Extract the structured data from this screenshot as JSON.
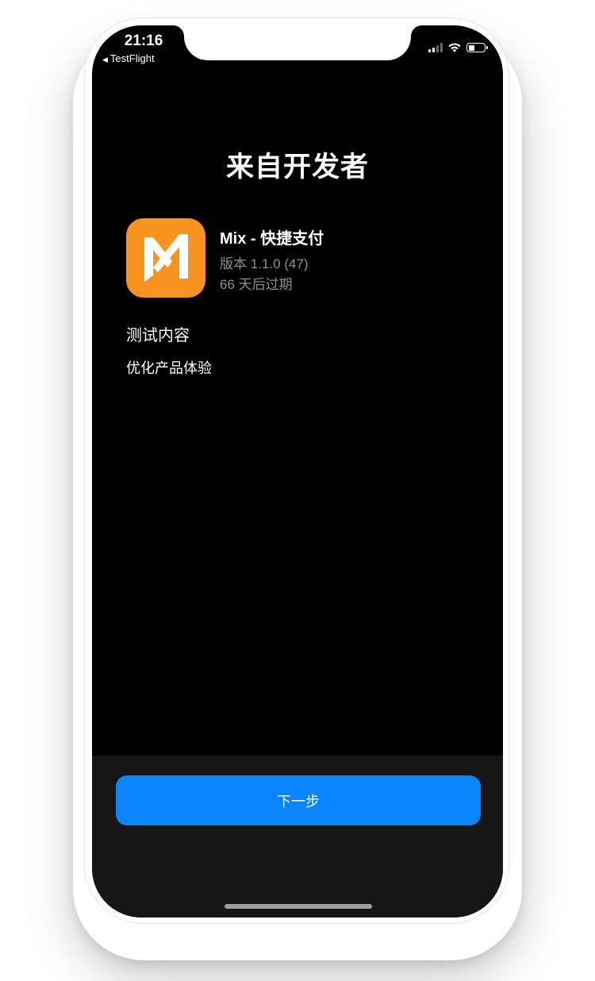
{
  "status_bar": {
    "time": "21:16",
    "back_app": "TestFlight",
    "back_icon": "back-triangle-icon",
    "icons": [
      "cellular-signal-icon",
      "wifi-icon",
      "battery-icon"
    ]
  },
  "page": {
    "title": "来自开发者"
  },
  "app": {
    "name": "Mix - 快捷支付",
    "version": "版本 1.1.0 (47)",
    "expiry": "66 天后过期",
    "icon": "mix-app-icon",
    "icon_color": "#F7931E"
  },
  "test_content": {
    "heading": "测试内容",
    "body": "优化产品体验"
  },
  "actions": {
    "next_label": "下一步",
    "accent_color": "#0A84FF"
  }
}
